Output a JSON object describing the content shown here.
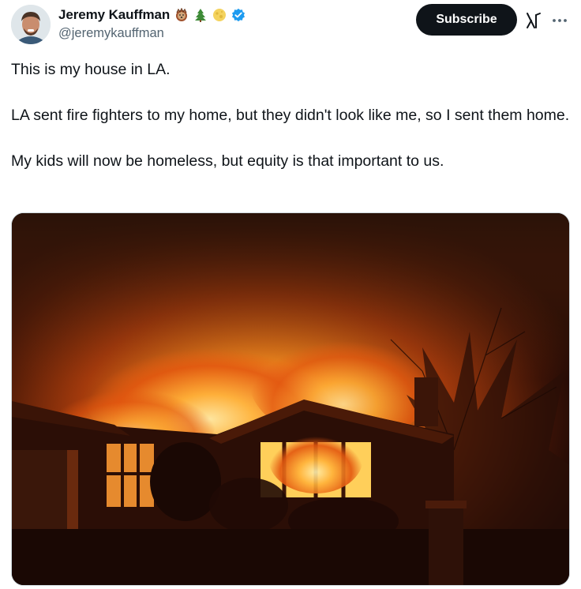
{
  "author": {
    "display_name": "Jeremy Kauffman",
    "handle": "@jeremykauffman",
    "badges": [
      "hedgehog-emoji",
      "evergreen-tree-emoji",
      "moon-emoji",
      "verified-badge-icon"
    ]
  },
  "actions": {
    "subscribe_label": "Subscribe",
    "grok_icon": "grok-icon",
    "more_icon": "more-options-icon"
  },
  "tweet": {
    "paragraphs": [
      "This is my house in LA.",
      "LA sent fire fighters to my home, but they didn't look like me, so I sent them home.",
      "My kids will now be homeless, but equity is that important to us."
    ]
  },
  "media": {
    "type": "photo"
  },
  "colors": {
    "text": "#0f1419",
    "secondary_text": "#536471",
    "verified": "#1d9bf0",
    "button_bg": "#0f1419"
  }
}
